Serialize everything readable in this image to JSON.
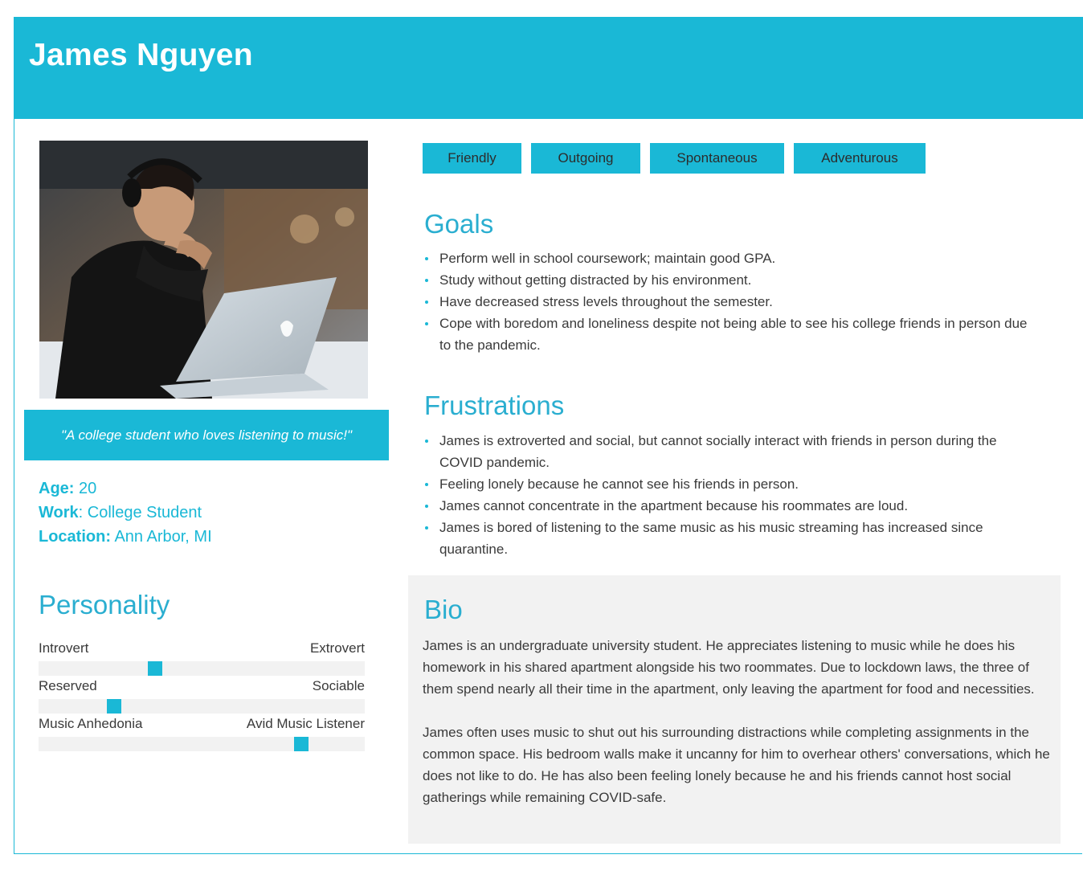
{
  "persona": {
    "name": "James Nguyen",
    "quote": "\"A college student who loves listening to music!\"",
    "facts": [
      {
        "label": "Age:",
        "value": "20"
      },
      {
        "label": "Work",
        "value": ": College Student"
      },
      {
        "label": "Location:",
        "value": "Ann Arbor, MI"
      }
    ]
  },
  "personality": {
    "title": "Personality",
    "scales": [
      {
        "left": "Introvert",
        "right": "Extrovert",
        "level": 0.35
      },
      {
        "left": "Reserved",
        "right": "Sociable",
        "level": 0.22
      },
      {
        "left": "Music Anhedonia",
        "right": "Avid Music Listener",
        "level": 0.82
      }
    ]
  },
  "tags": [
    "Friendly",
    "Outgoing",
    "Spontaneous",
    "Adventurous"
  ],
  "goals": {
    "title": "Goals",
    "items": [
      "Perform well in school coursework; maintain good GPA.",
      "Study without getting distracted by his environment.",
      "Have decreased stress levels throughout the semester.",
      "Cope with boredom and loneliness despite not being able to see his college friends in person due to the pandemic."
    ]
  },
  "frustrations": {
    "title": "Frustrations",
    "items": [
      "James is extroverted and social, but cannot socially interact with friends in person during the COVID pandemic.",
      "Feeling lonely because he cannot see his friends in person.",
      "James cannot concentrate in the apartment because his roommates are loud.",
      "James is bored of listening to the same music as his music streaming has increased since  quarantine."
    ]
  },
  "bio": {
    "title": "Bio",
    "paragraphs": [
      "James is an undergraduate university student. He appreciates listening to music while he does his homework in his shared apartment alongside his two roommates. Due to lockdown laws, the three of them spend nearly all their time in the apartment, only leaving the apartment for food and necessities.",
      "James often uses music to shut out his surrounding distractions while completing assignments in the common space. His bedroom walls make it uncanny for him to overhear others' conversations, which he does not like to do. He has also been feeling lonely because he and his friends cannot host social gatherings while remaining COVID-safe."
    ]
  },
  "colors": {
    "accent": "#1ab8d6",
    "panel": "#f2f2f2",
    "text": "#3a3a3a"
  }
}
